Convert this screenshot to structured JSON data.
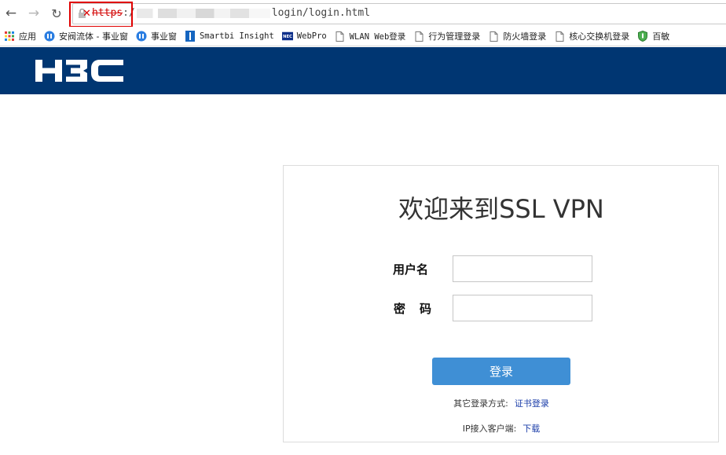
{
  "browser": {
    "back_icon": "back-arrow-icon",
    "forward_icon": "forward-arrow-icon",
    "reload_icon": "reload-icon",
    "url_scheme": "https",
    "url_sep": ":/",
    "url_path": "login/login.html",
    "security_icon": "broken-lock-icon"
  },
  "bookmarks": [
    {
      "label": "应用",
      "icon": "apps-grid-icon"
    },
    {
      "label": "安阀流体 - 事业窗",
      "icon": "circle-logo-icon"
    },
    {
      "label": "事业窗",
      "icon": "circle-logo-icon"
    },
    {
      "label": "Smartbi Insight",
      "icon": "smartbi-icon"
    },
    {
      "label": "WebPro",
      "icon": "nec-icon"
    },
    {
      "label": "WLAN Web登录",
      "icon": "page-icon"
    },
    {
      "label": "行为管理登录",
      "icon": "page-icon"
    },
    {
      "label": "防火墙登录",
      "icon": "page-icon"
    },
    {
      "label": "核心交换机登录",
      "icon": "page-icon"
    },
    {
      "label": "百敏",
      "icon": "shield-icon"
    }
  ],
  "header": {
    "logo_text": "H3C",
    "brand_color": "#003672"
  },
  "login": {
    "welcome": "欢迎来到SSL VPN",
    "username_label": "用户名",
    "password_label": "密码",
    "username_value": "",
    "password_value": "",
    "login_button": "登录",
    "other_login_prefix": "其它登录方式:",
    "cert_login_link": "证书登录",
    "ip_client_prefix": "IP接入客户端:",
    "download_link": "下载",
    "button_color": "#3f8fd5"
  }
}
